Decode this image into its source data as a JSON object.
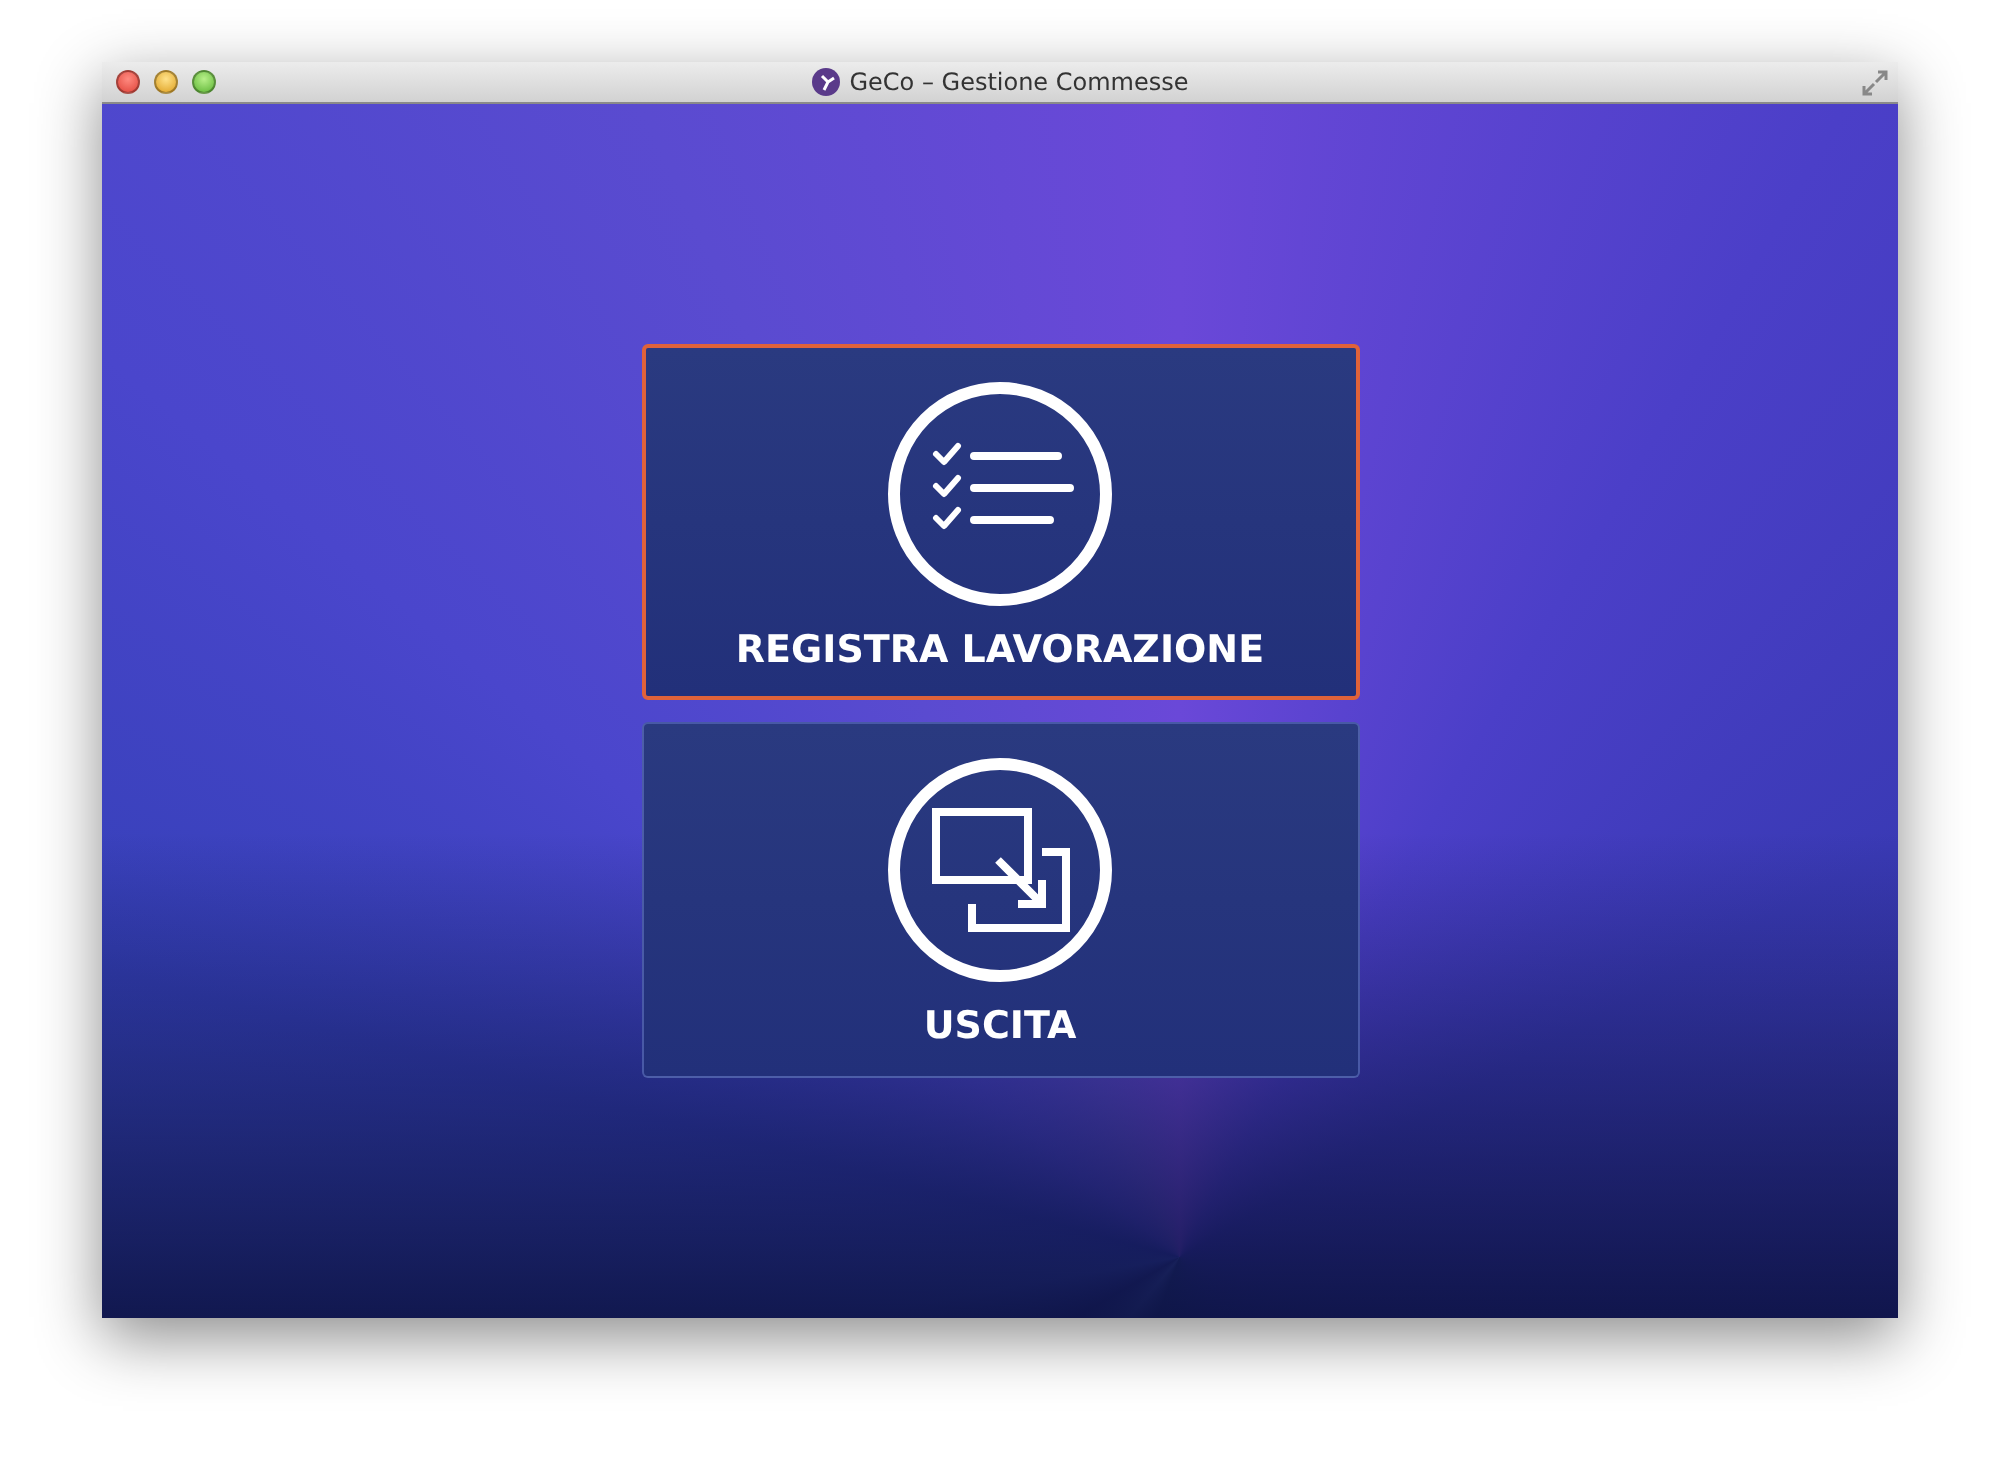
{
  "window": {
    "title": "GeCo – Gestione Commesse"
  },
  "buttons": [
    {
      "label": "REGISTRA LAVORAZIONE",
      "kind": "checklist",
      "focused": true
    },
    {
      "label": "USCITA",
      "kind": "exit",
      "focused": false
    }
  ]
}
